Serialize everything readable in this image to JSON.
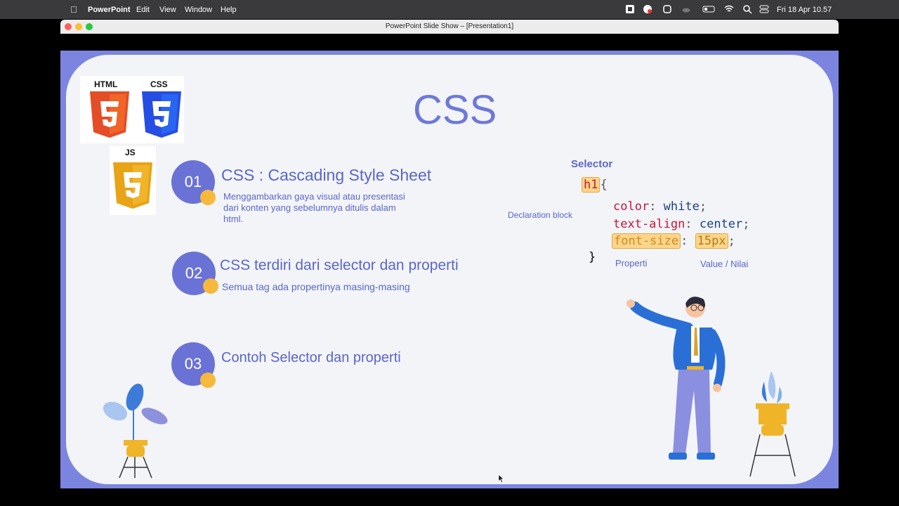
{
  "menubar": {
    "app_name": "PowerPoint",
    "items": [
      "Edit",
      "View",
      "Window",
      "Help"
    ],
    "clock": "Fri 18 Apr  10.57"
  },
  "window": {
    "title": "PowerPoint Slide Show – [Presentation1]"
  },
  "slide": {
    "title": "CSS",
    "logos": {
      "html": "HTML",
      "css": "CSS",
      "js": "JS"
    },
    "points": [
      {
        "number": "01",
        "title": "CSS : Cascading Style Sheet",
        "desc_lines": [
          "Menggambarkan gaya visual atau presentasi",
          "dari konten yang sebelumnya ditulis dalam",
          "html."
        ]
      },
      {
        "number": "02",
        "title": "CSS terdiri dari selector dan properti",
        "desc_lines": [
          "Semua tag ada propertinya masing-masing"
        ]
      },
      {
        "number": "03",
        "title": "Contoh Selector dan properti",
        "desc_lines": []
      }
    ],
    "code": {
      "selector": "h1",
      "open_brace": "{",
      "close_brace": "}",
      "declarations": [
        {
          "prop": "color",
          "value": "white"
        },
        {
          "prop": "text-align",
          "value": "center"
        },
        {
          "prop": "font-size",
          "value": "15px"
        }
      ]
    },
    "annotations": {
      "selector": "Selector",
      "declaration_block": "Declaration block",
      "property": "Properti",
      "value": "Value / Nilai"
    }
  },
  "colors": {
    "accent": "#6a72d6",
    "dot": "#f6b93b",
    "slide_border": "#7b85e0"
  }
}
